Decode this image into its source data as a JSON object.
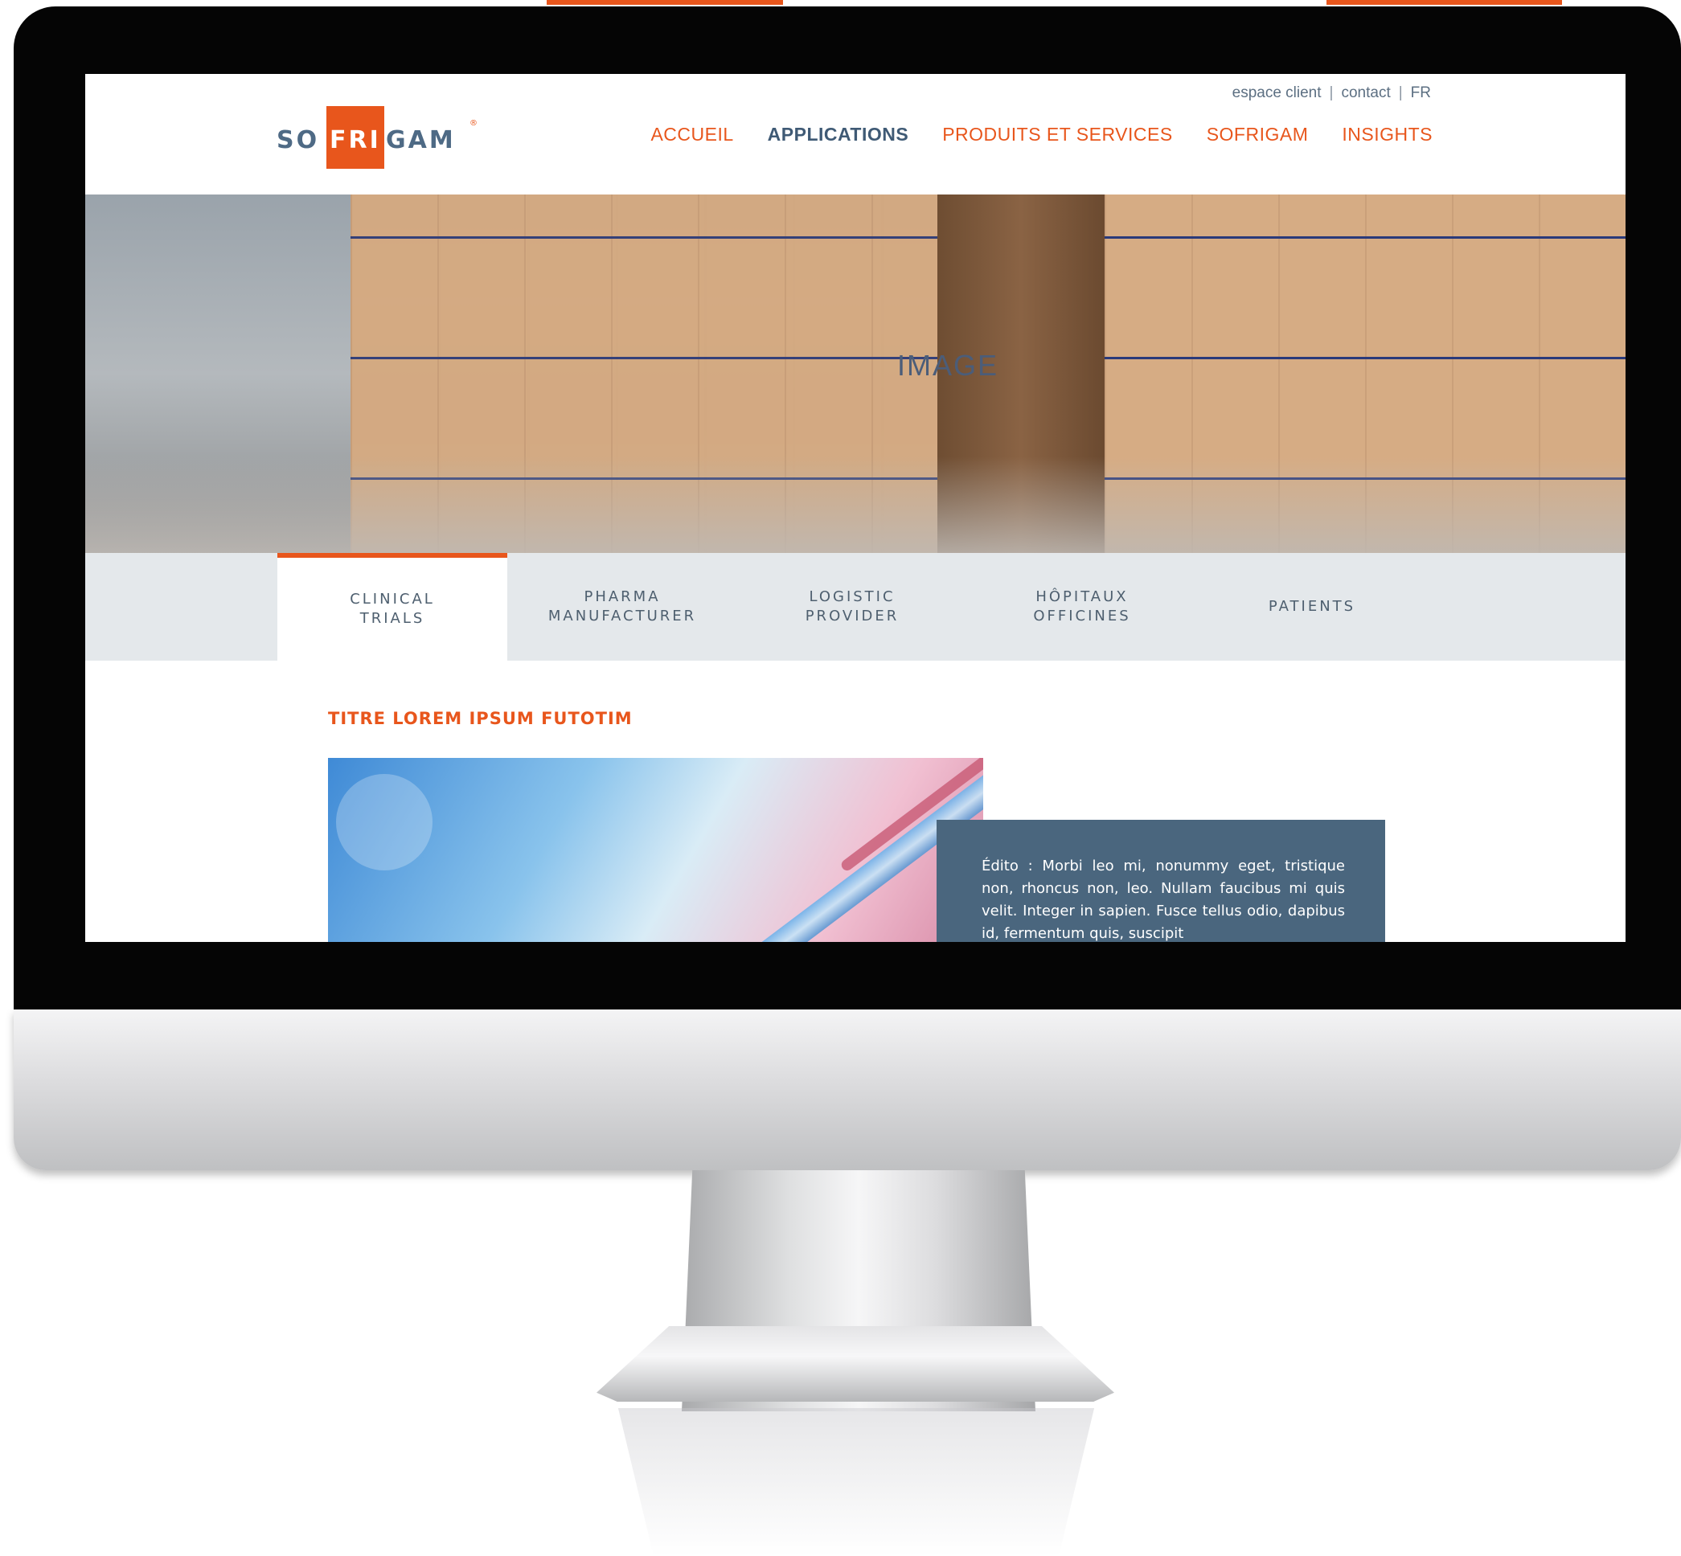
{
  "utility_links": {
    "client": "espace client",
    "contact": "contact",
    "lang": "FR",
    "separator": "|"
  },
  "logo": {
    "part1": "SO",
    "part2": "FRI",
    "part3": "GAM",
    "mark": "®"
  },
  "nav": [
    {
      "label": "ACCUEIL",
      "active": false
    },
    {
      "label": "APPLICATIONS",
      "active": true
    },
    {
      "label": "PRODUITS ET SERVICES",
      "active": false
    },
    {
      "label": "SOFRIGAM",
      "active": false
    },
    {
      "label": "INSIGHTS",
      "active": false
    }
  ],
  "hero": {
    "watermark": "IMAGE"
  },
  "tabs": [
    {
      "line1": "CLINICAL",
      "line2": "TRIALS",
      "active": true
    },
    {
      "line1": "PHARMA",
      "line2": "MANUFACTURER",
      "active": false
    },
    {
      "line1": "LOGISTIC",
      "line2": "PROVIDER",
      "active": false
    },
    {
      "line1": "HÔPITAUX",
      "line2": "OFFICINES",
      "active": false
    },
    {
      "line1": "PATIENTS",
      "line2": "",
      "active": false
    }
  ],
  "content": {
    "title": "TITRE LOREM IPSUM FUTOTIM",
    "edito": "Édito : Morbi leo mi, nonummy eget, tristique non, rhoncus non, leo. Nullam faucibus mi quis velit. Integer in sapien. Fusce tellus odio, dapibus id, fermentum quis, suscipit"
  },
  "colors": {
    "accent": "#e8561c",
    "navy": "#3f5a75",
    "tab_bg": "#e4e8eb",
    "edito_bg": "#4a667e"
  }
}
